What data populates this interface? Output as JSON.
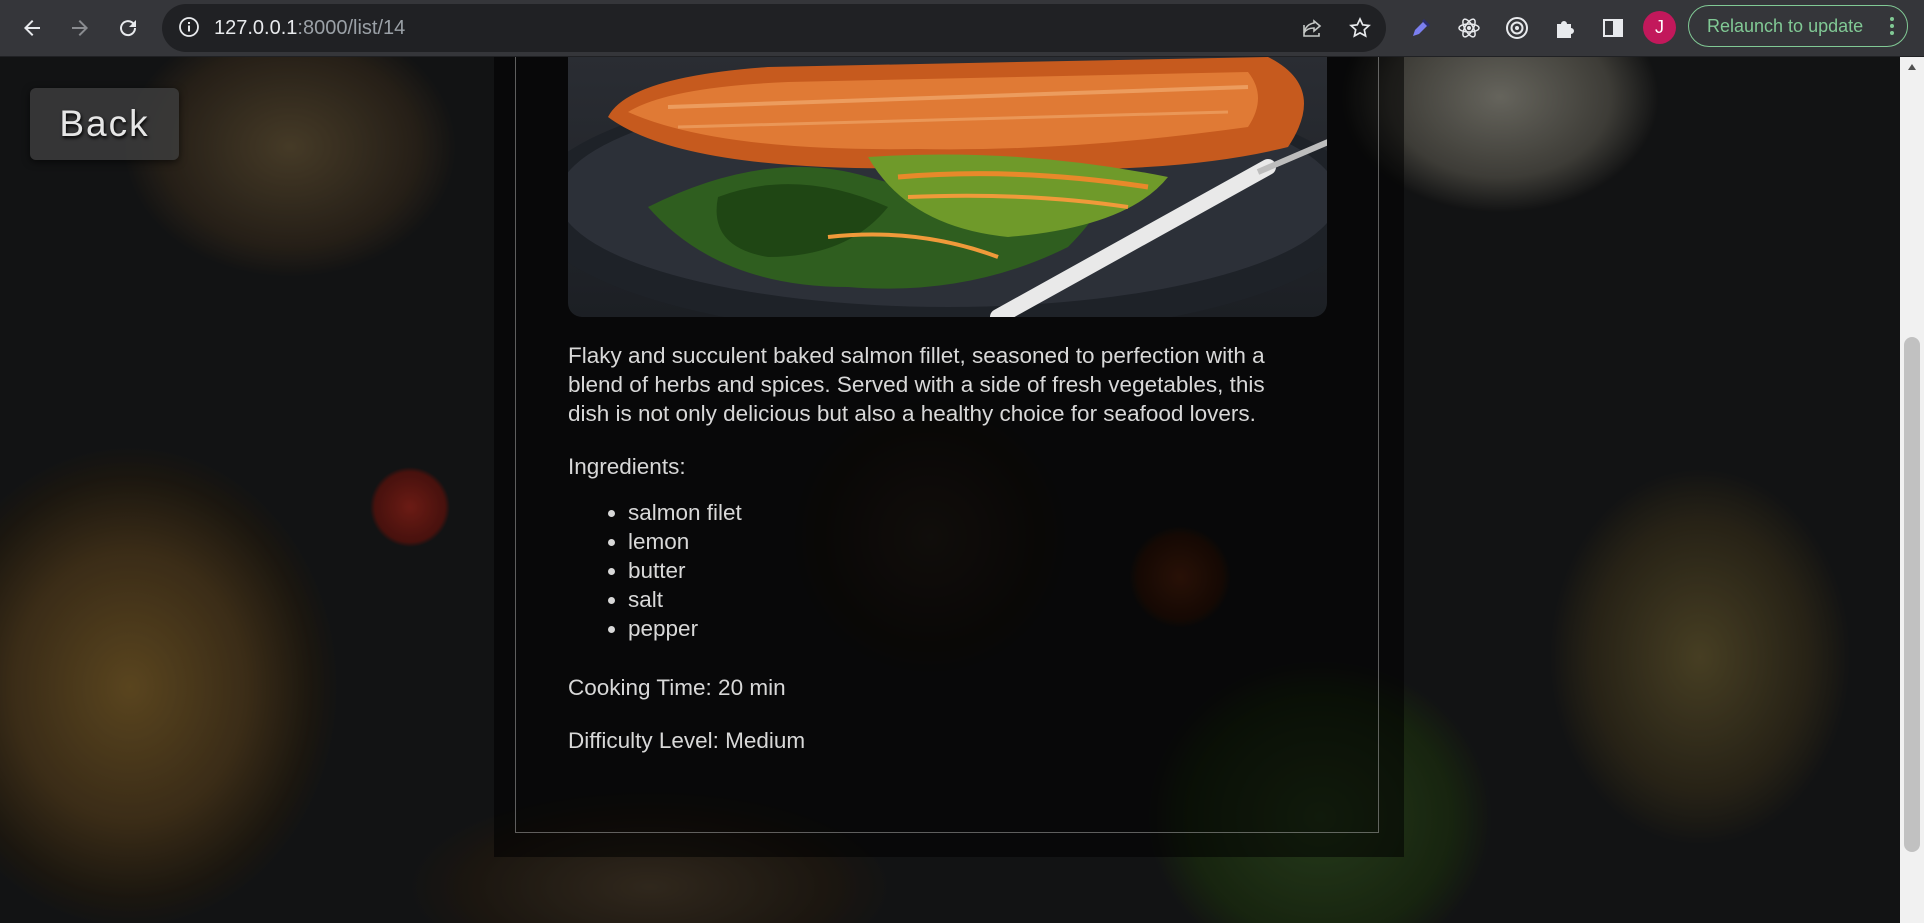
{
  "browser": {
    "url_host": "127.0.0.1",
    "url_path": ":8000/list/14",
    "profile_initial": "J",
    "relaunch_label": "Relaunch to update",
    "icons": [
      "back-arrow-icon",
      "forward-arrow-icon",
      "reload-icon",
      "site-info-icon",
      "share-icon",
      "bookmark-star-icon",
      "eyedropper-icon",
      "react-devtools-icon",
      "circle-target-icon",
      "extensions-puzzle-icon",
      "side-panel-icon",
      "menu-dots-icon"
    ]
  },
  "page": {
    "back_label": "Back",
    "description": "Flaky and succulent baked salmon fillet, seasoned to perfection with a blend of herbs and spices. Served with a side of fresh vegetables, this dish is not only delicious but also a healthy choice for seafood lovers.",
    "ingredients_title": "Ingredients:",
    "ingredients": [
      "salmon filet",
      "lemon",
      "butter",
      "salt",
      "pepper"
    ],
    "cooking_time": "Cooking Time: 20 min",
    "difficulty": "Difficulty Level: Medium"
  }
}
